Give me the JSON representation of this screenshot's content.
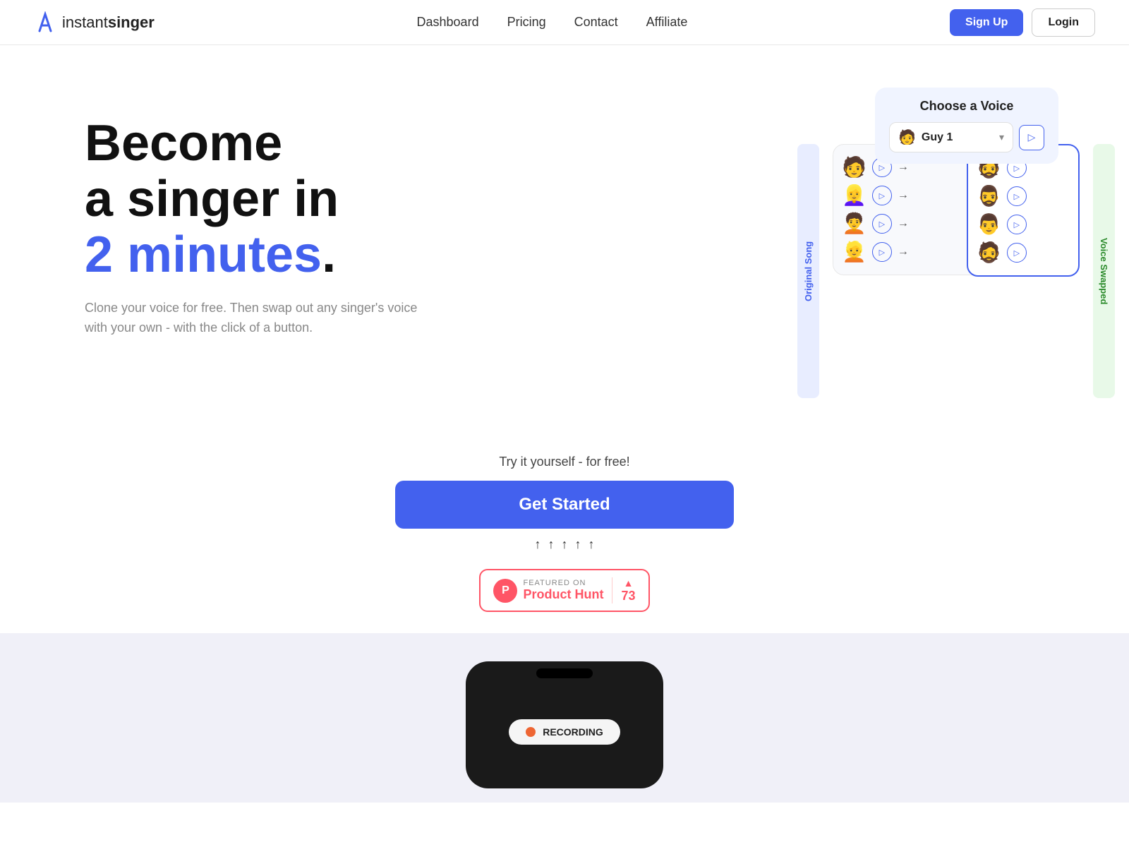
{
  "navbar": {
    "logo_instant": "instant",
    "logo_singer": "singer",
    "links": [
      {
        "label": "Dashboard",
        "id": "dashboard"
      },
      {
        "label": "Pricing",
        "id": "pricing"
      },
      {
        "label": "Contact",
        "id": "contact"
      },
      {
        "label": "Affiliate",
        "id": "affiliate"
      }
    ],
    "signup_label": "Sign Up",
    "login_label": "Login"
  },
  "hero": {
    "title_line1": "Become",
    "title_line2": "a singer in",
    "title_line3_blue": "2 minutes",
    "title_line3_suffix": ".",
    "subtitle": "Clone your voice for free. Then swap out any singer's voice with your own - with the click of a button."
  },
  "voice_widget": {
    "choose_label": "Choose a Voice",
    "selected_voice_emoji": "🧑",
    "selected_voice_name": "Guy 1",
    "original_song_label": "Original Song",
    "voice_swapped_label": "Voice Swapped",
    "rows": [
      {
        "emoji": "🧑",
        "id": "row1"
      },
      {
        "emoji": "👱‍♀️",
        "id": "row2"
      },
      {
        "emoji": "🧑‍🦱",
        "id": "row3"
      },
      {
        "emoji": "👱",
        "id": "row4"
      }
    ],
    "swapped_rows": [
      {
        "emoji": "🧔",
        "id": "swap1"
      },
      {
        "emoji": "🧔‍♂️",
        "id": "swap2"
      },
      {
        "emoji": "👨",
        "id": "swap3"
      },
      {
        "emoji": "🧔",
        "id": "swap4"
      }
    ]
  },
  "cta": {
    "subtext": "Try it yourself - for free!",
    "button_label": "Get Started",
    "arrows": [
      "↑",
      "↑",
      "↑",
      "↑",
      "↑"
    ]
  },
  "product_hunt": {
    "featured_text": "FEATURED ON",
    "main_text": "Product Hunt",
    "count": "73",
    "triangle": "▲"
  },
  "bottom": {
    "recording_label": "RECORDING"
  }
}
